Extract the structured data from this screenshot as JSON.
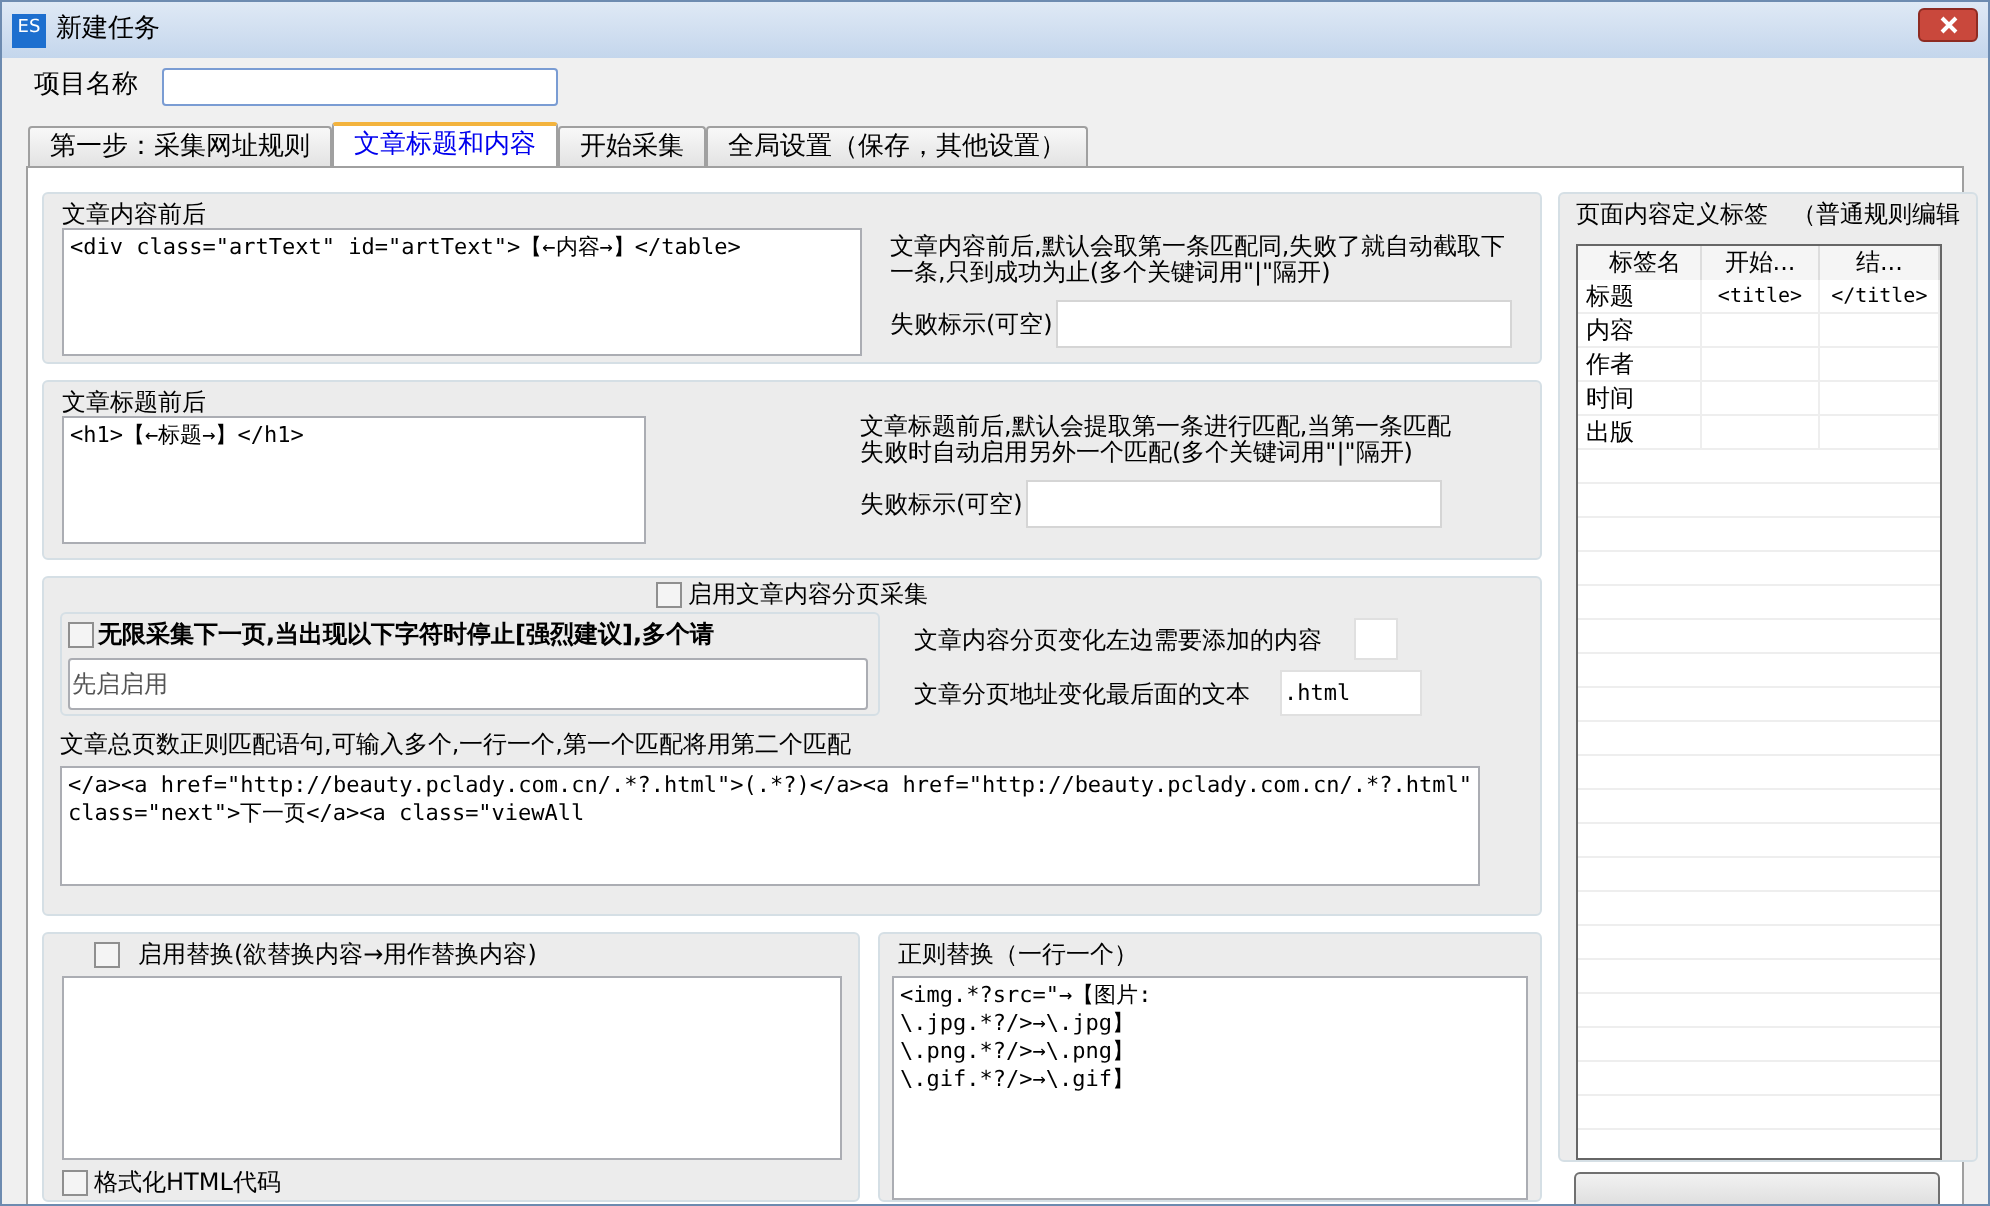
{
  "window": {
    "title": "新建任务",
    "icon_text": "ES"
  },
  "project_name": {
    "label": "项目名称"
  },
  "tabs": [
    {
      "label": "第一步：采集网址规则",
      "selected": false
    },
    {
      "label": "文章标题和内容",
      "selected": true
    },
    {
      "label": "开始采集",
      "selected": false
    },
    {
      "label": "全局设置（保存，其他设置）",
      "selected": false
    }
  ],
  "content_group": {
    "legend": "文章内容前后",
    "value": "<div class=\"artText\" id=\"artText\">【←内容→】</table>",
    "description": "文章内容前后,默认会取第一条匹配同,失败了就自动截取下一条,只到成功为止(多个关键词用\"|\"隔开)",
    "fail_label": "失败标示(可空)"
  },
  "title_group": {
    "legend": "文章标题前后",
    "value": "<h1>【←标题→】</h1>",
    "description": "文章标题前后,默认会提取第一条进行匹配,当第一条匹配失败时自动启用另外一个匹配(多个关键词用\"|\"隔开)",
    "fail_label": "失败标示(可空)"
  },
  "paging_group": {
    "legend": "启用文章内容分页采集",
    "checked": false,
    "stop_group": {
      "legend": "无限采集下一页,当出现以下字符时停止[强烈建议],多个请",
      "checked": false,
      "placeholder": "先启启用"
    },
    "left_add_label": "文章内容分页变化左边需要添加的内容",
    "suffix_label": "文章分页地址变化最后面的文本",
    "suffix_value": ".html",
    "regex_label": "文章总页数正则匹配语句,可输入多个,一行一个,第一个匹配将用第二个匹配",
    "regex_value": "</a><a href=\"http://beauty.pclady.com.cn/.*?.html\">(.*?)</a><a href=\"http://beauty.pclady.com.cn/.*?.html\" class=\"next\">下一页</a><a class=\"viewAll"
  },
  "replace_group": {
    "legend": "启用替换(欲替换内容→用作替换内容)",
    "checked": false,
    "format_label": "格式化HTML代码",
    "format_checked": false
  },
  "regex_replace": {
    "legend": "正则替换（一行一个）",
    "value": "<img.*?src=\"→【图片:\n\\.jpg.*?/>→\\.jpg】\n\\.png.*?/>→\\.png】\n\\.gif.*?/>→\\.gif】"
  },
  "tags_panel": {
    "legend": "页面内容定义标签　（普通规则编辑",
    "columns": [
      "标签名",
      "开始...",
      "结..."
    ],
    "rows": [
      [
        "标题",
        "<title>",
        "</title>"
      ],
      [
        "内容",
        "",
        ""
      ],
      [
        "作者",
        "",
        ""
      ],
      [
        "时间",
        "",
        ""
      ],
      [
        "出版",
        "",
        ""
      ]
    ]
  }
}
